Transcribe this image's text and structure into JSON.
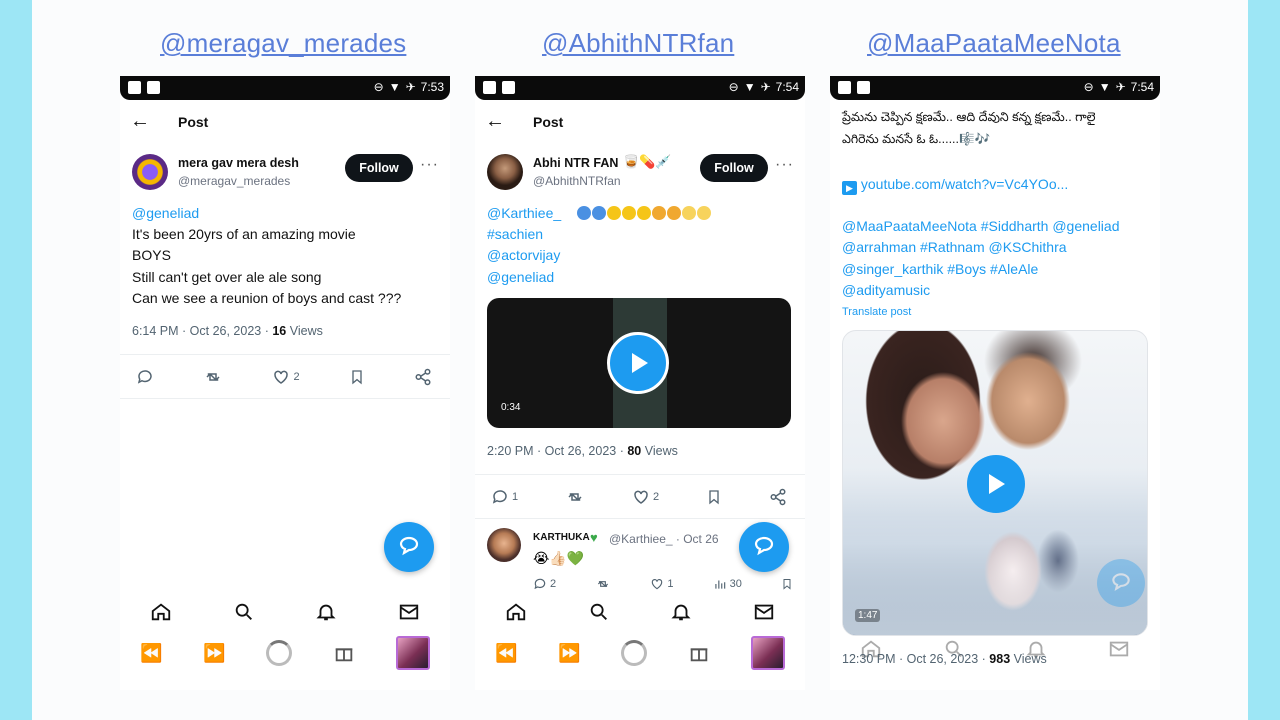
{
  "panels": [
    {
      "handle": "@meragav_merades",
      "status_time": "7:53",
      "header_title": "Post",
      "author_name": "mera gav mera desh",
      "author_handle": "@meragav_merades",
      "follow_label": "Follow",
      "body_lines": [
        "@geneliad",
        "It's been 20yrs of an amazing movie",
        "BOYS",
        "Still can't get over ale ale song",
        "Can we see a reunion of boys and cast ???"
      ],
      "meta_time": "6:14 PM · Oct 26, 2023 · ",
      "meta_views_count": "16",
      "meta_views_label": " Views",
      "likes": "2"
    },
    {
      "handle": "@AbhithNTRfan",
      "status_time": "7:54",
      "header_title": "Post",
      "author_name": "Abhi NTR FAN",
      "author_handle": "@AbhithNTRfan",
      "follow_label": "Follow",
      "body_lines": [
        "@Karthiee_",
        "#sachien",
        "@actorvijay",
        "@geneliad"
      ],
      "video_duration": "0:34",
      "meta_time": "2:20 PM · Oct 26, 2023 · ",
      "meta_views_count": "80",
      "meta_views_label": " Views",
      "replies": "1",
      "likes": "2",
      "reply": {
        "name": "KARTHUKA",
        "handle": "@Karthiee_ · Oct 26",
        "replies": "2",
        "likes": "1",
        "views": "30"
      }
    },
    {
      "handle": "@MaaPaataMeeNota",
      "status_time": "7:54",
      "telugu_lines": [
        "ప్రేమను చెప్పిన క్షణమే.. ఆది దేవుని కన్న క్షణమే.. గాలై",
        "ఎగిరెను మనసే ఓ ఓ......🎼🎶"
      ],
      "youtube_link": "youtube.com/watch?v=Vc4YOo...",
      "tag_lines": [
        "@MaaPaataMeeNota #Siddharth @geneliad",
        "@arrahman #Rathnam @KSChithra",
        "@singer_karthik #Boys #AleAle",
        "@adityamusic"
      ],
      "translate_label": "Translate post",
      "video_duration": "1:47",
      "meta_time": "12:30 PM · Oct 26, 2023 · ",
      "meta_views_count": "983",
      "meta_views_label": " Views"
    }
  ],
  "colors": {
    "outer_bg": "#9de6f5",
    "canvas_bg": "#fbfcfd",
    "handle_color": "#5a7ed8",
    "twitter_blue": "#1d9bf0"
  },
  "icons": [
    "back-arrow-icon",
    "more-icon",
    "reply-icon",
    "retweet-icon",
    "like-icon",
    "bookmark-icon",
    "share-icon",
    "compose-icon",
    "home-icon",
    "search-icon",
    "bell-icon",
    "mail-icon",
    "rewind-icon",
    "fast-forward-icon",
    "loading-icon",
    "gift-icon",
    "play-icon"
  ]
}
